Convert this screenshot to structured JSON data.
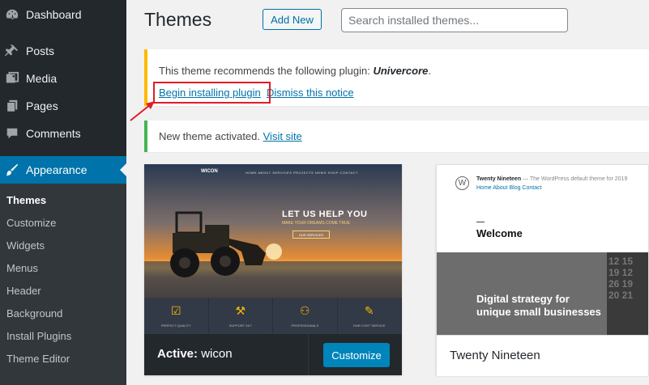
{
  "sidebar": {
    "menu": [
      {
        "label": "Dashboard",
        "icon": "dashboard-icon"
      },
      {
        "label": "Posts",
        "icon": "pin-icon"
      },
      {
        "label": "Media",
        "icon": "media-icon"
      },
      {
        "label": "Pages",
        "icon": "pages-icon"
      },
      {
        "label": "Comments",
        "icon": "comments-icon"
      },
      {
        "label": "Appearance",
        "icon": "brush-icon"
      }
    ],
    "submenu": [
      "Themes",
      "Customize",
      "Widgets",
      "Menus",
      "Header",
      "Background",
      "Install Plugins",
      "Theme Editor"
    ]
  },
  "header": {
    "title": "Themes",
    "add_new": "Add New",
    "search_placeholder": "Search installed themes..."
  },
  "notices": {
    "plugin": {
      "prefix": "This theme recommends the following plugin: ",
      "plugin_name": "Univercore",
      "suffix": ".",
      "install_link": "Begin installing plugin",
      "dismiss_link": "Dismiss this notice"
    },
    "activated": {
      "text": "New theme activated. ",
      "link": "Visit site"
    }
  },
  "themes": {
    "active": {
      "label_prefix": "Active:",
      "name": "wicon",
      "customize": "Customize",
      "preview": {
        "logo": "WICON",
        "nav": "HOME   ABOUT   SERVICES   PROJECTS   NEWS   SHOP   CONTACT",
        "headline": "LET US HELP YOU",
        "sub": "MAKE YOUR DREAMS COME TRUE",
        "button": "OUR SERVICES",
        "features": [
          "PERFECT QUALITY",
          "SUPPORT 24/7",
          "PROFESSIONALS",
          "FAIR COST SERVICE"
        ]
      }
    },
    "other": {
      "name": "Twenty Nineteen",
      "preview": {
        "site_title": "Twenty Nineteen",
        "site_desc": " — The WordPress default theme for 2019",
        "menu": "Home  About  Blog  Contact",
        "welcome": "Welcome",
        "tagline_1": "Digital strategy for",
        "tagline_2": "unique small businesses"
      }
    }
  },
  "colors": {
    "sidebar_bg": "#23282d",
    "accent": "#0073aa",
    "warning": "#ffb900",
    "success": "#46b450",
    "highlight": "#e11d24"
  }
}
